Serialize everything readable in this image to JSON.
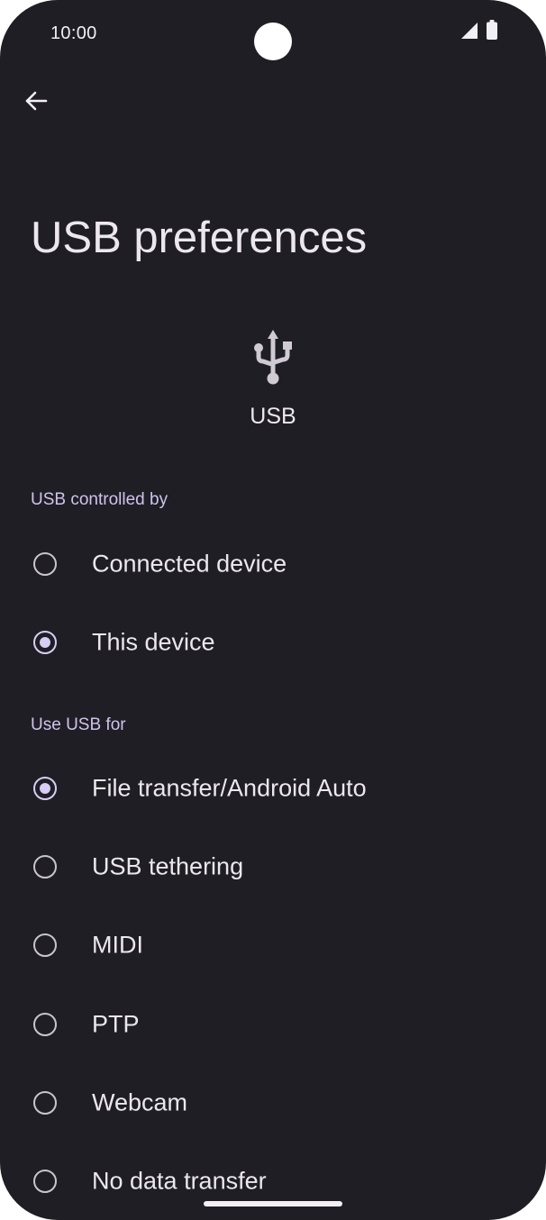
{
  "status_bar": {
    "time": "10:00",
    "icons": [
      "signal-icon",
      "battery-icon"
    ]
  },
  "toolbar": {
    "back_icon": "arrow-left-icon"
  },
  "page": {
    "title": "USB preferences",
    "hero_icon": "usb-icon",
    "hero_label": "USB"
  },
  "controlled_by": {
    "header": "USB controlled by",
    "options": [
      {
        "label": "Connected device",
        "checked": false
      },
      {
        "label": "This device",
        "checked": true
      }
    ]
  },
  "use_usb_for": {
    "header": "Use USB for",
    "options": [
      {
        "label": "File transfer/Android Auto",
        "checked": true
      },
      {
        "label": "USB tethering",
        "checked": false
      },
      {
        "label": "MIDI",
        "checked": false
      },
      {
        "label": "PTP",
        "checked": false
      },
      {
        "label": "Webcam",
        "checked": false
      },
      {
        "label": "No data transfer",
        "checked": false
      }
    ]
  },
  "colors": {
    "background": "#1f1e24",
    "text": "#ece7ee",
    "accent": "#d7cdf6",
    "section_header": "#cfc3ee"
  }
}
